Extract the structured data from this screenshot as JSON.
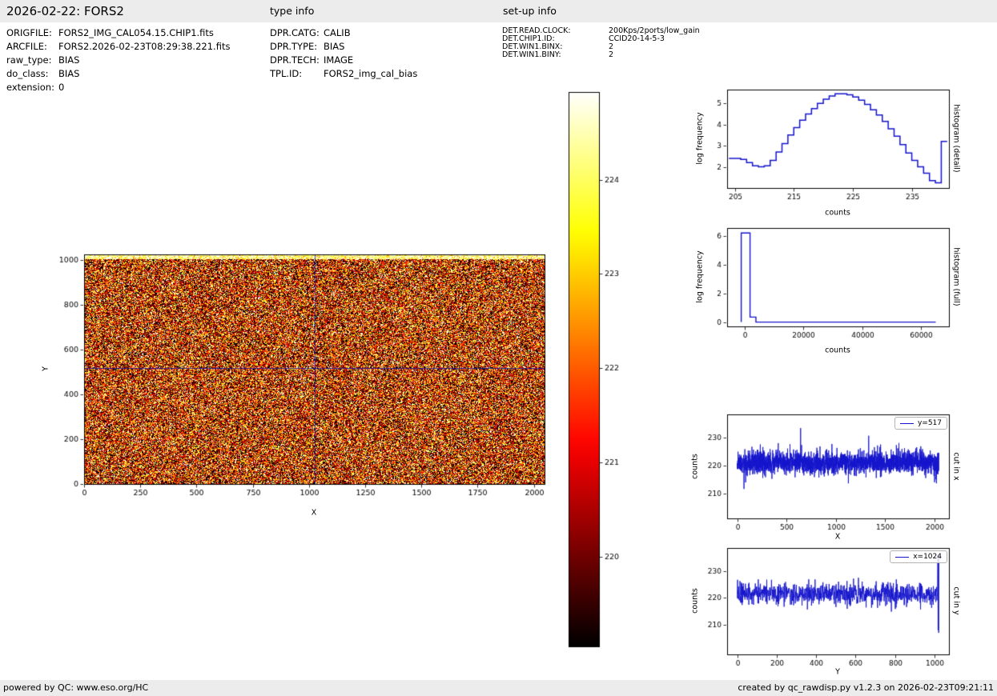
{
  "header": {
    "title": "2026-02-22: FORS2",
    "type_info_label": "type info",
    "setup_info_label": "set-up info"
  },
  "file_info": {
    "rows": [
      {
        "label": "ORIGFILE:",
        "value": "FORS2_IMG_CAL054.15.CHIP1.fits"
      },
      {
        "label": "ARCFILE:",
        "value": "FORS2.2026-02-23T08:29:38.221.fits"
      },
      {
        "label": "raw_type:",
        "value": "BIAS"
      },
      {
        "label": "do_class:",
        "value": "BIAS"
      },
      {
        "label": "extension:",
        "value": "0"
      }
    ]
  },
  "type_info": {
    "rows": [
      {
        "label": "DPR.CATG:",
        "value": "CALIB"
      },
      {
        "label": "DPR.TYPE:",
        "value": "BIAS"
      },
      {
        "label": "DPR.TECH:",
        "value": "IMAGE"
      },
      {
        "label": "TPL.ID:",
        "value": "FORS2_img_cal_bias"
      }
    ]
  },
  "setup_info": {
    "rows": [
      {
        "label": "DET.READ.CLOCK:",
        "value": "200Kps/2ports/low_gain"
      },
      {
        "label": "DET.CHIP1.ID:",
        "value": "CCID20-14-5-3"
      },
      {
        "label": "DET.WIN1.BINX:",
        "value": "2"
      },
      {
        "label": "DET.WIN1.BINY:",
        "value": "2"
      }
    ]
  },
  "footer": {
    "left": "powered by QC: www.eso.org/HC",
    "right": "created by qc_rawdisp.py v1.2.3 on 2026-02-23T09:21:11"
  },
  "chart_data": [
    {
      "id": "bias-image",
      "type": "heatmap",
      "xlabel": "X",
      "ylabel": "Y",
      "xlim": [
        0,
        2048
      ],
      "ylim": [
        0,
        1024
      ],
      "xticks": [
        0,
        250,
        500,
        750,
        1000,
        1250,
        1500,
        1750,
        2000
      ],
      "yticks": [
        0,
        200,
        400,
        600,
        800,
        1000
      ],
      "colormap": "hot",
      "color_range": [
        219.05,
        224.93
      ],
      "noise": {
        "mean": 221.3,
        "std": 2.4,
        "seed": 7,
        "top_band_y": 1004,
        "top_band_mean": 224.3,
        "top_band_std": 1.0
      },
      "crosshair": {
        "x": 1024,
        "y": 517,
        "color": "#1919a6"
      }
    },
    {
      "id": "colorbar",
      "type": "colorbar",
      "colormap": "hot",
      "range": [
        219.05,
        224.93
      ],
      "ticks": [
        220,
        221,
        222,
        223,
        224
      ]
    },
    {
      "id": "histogram-detail",
      "type": "line",
      "style": "step",
      "xlabel": "counts",
      "ylabel": "log frequency",
      "right_label": "histogram (detail)",
      "xlim": [
        203.7,
        241.3
      ],
      "ylim": [
        1.0,
        5.65
      ],
      "xticks": [
        205,
        215,
        225,
        235
      ],
      "yticks": [
        2,
        3,
        4,
        5
      ],
      "color": "#1414cc",
      "x_start": 204,
      "bin_width": 1,
      "values": [
        2.4,
        2.4,
        2.35,
        2.2,
        2.05,
        2.0,
        2.05,
        2.3,
        2.7,
        3.1,
        3.5,
        3.85,
        4.2,
        4.5,
        4.75,
        5.0,
        5.2,
        5.35,
        5.45,
        5.45,
        5.4,
        5.3,
        5.15,
        4.95,
        4.7,
        4.45,
        4.15,
        3.8,
        3.45,
        3.05,
        2.65,
        2.3,
        2.0,
        1.7,
        1.35,
        1.25,
        3.2
      ]
    },
    {
      "id": "histogram-full",
      "type": "line",
      "style": "step-points",
      "xlabel": "counts",
      "ylabel": "log frequency",
      "right_label": "histogram (full)",
      "xlim": [
        -6000,
        69500
      ],
      "ylim": [
        -0.3,
        6.55
      ],
      "xticks": [
        0,
        20000,
        40000,
        60000
      ],
      "yticks": [
        0,
        2,
        4,
        6
      ],
      "color": "#1414cc",
      "points": [
        [
          -1200,
          0
        ],
        [
          -1200,
          6.2
        ],
        [
          1800,
          6.2
        ],
        [
          1800,
          0.35
        ],
        [
          3800,
          0.35
        ],
        [
          3800,
          0
        ],
        [
          65000,
          0
        ]
      ]
    },
    {
      "id": "cut-in-x",
      "type": "line",
      "style": "noise",
      "legend": "y=517",
      "xlabel": "X",
      "ylabel": "counts",
      "right_label": "cut in x",
      "xlim": [
        -102,
        2150
      ],
      "ylim": [
        201,
        238.5
      ],
      "xticks": [
        0,
        500,
        1000,
        1500,
        2000
      ],
      "yticks": [
        210,
        220,
        230
      ],
      "color": "#1414cc",
      "noise": {
        "n": 2048,
        "mean": 221.2,
        "std": 2.1,
        "seed": 11,
        "outlier_prob": 0.005,
        "outlier_min": 5,
        "outlier_max": 10
      }
    },
    {
      "id": "cut-in-y",
      "type": "line",
      "style": "noise",
      "legend": "x=1024",
      "xlabel": "Y",
      "ylabel": "counts",
      "right_label": "cut in y",
      "xlim": [
        -51,
        1074
      ],
      "ylim": [
        199,
        238.5
      ],
      "xticks": [
        0,
        200,
        400,
        600,
        800,
        1000
      ],
      "yticks": [
        210,
        220,
        230
      ],
      "color": "#1414cc",
      "noise": {
        "n": 1024,
        "mean": 221.3,
        "std": 2.1,
        "seed": 13,
        "outlier_prob": 0.004,
        "outlier_min": 5,
        "outlier_max": 9
      },
      "end_spike": {
        "from": 1016,
        "values": [
          222,
          231,
          236,
          208,
          236,
          235,
          207,
          236
        ]
      }
    }
  ]
}
